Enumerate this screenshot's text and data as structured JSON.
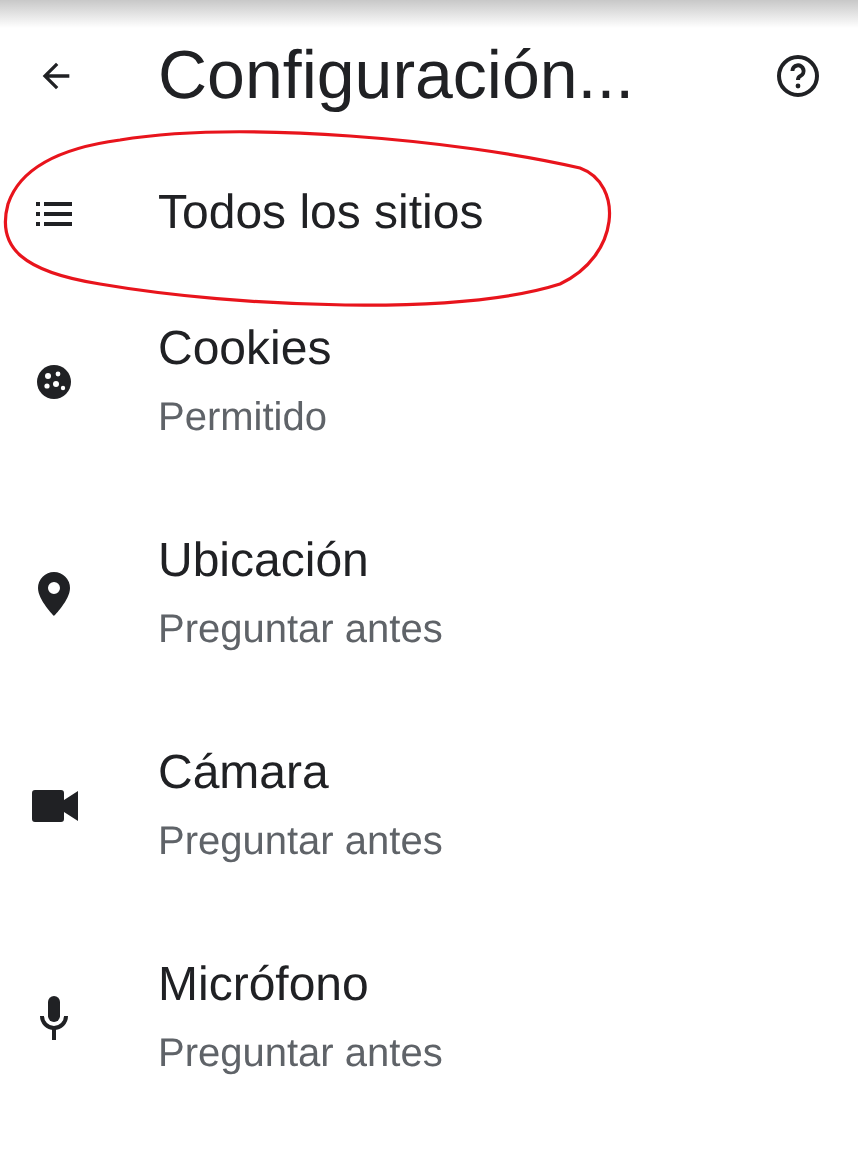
{
  "header": {
    "title": "Configuración..."
  },
  "items": [
    {
      "kind": "list",
      "label": "Todos los sitios"
    },
    {
      "kind": "cookie",
      "label": "Cookies",
      "status": "Permitido"
    },
    {
      "kind": "location",
      "label": "Ubicación",
      "status": "Preguntar antes"
    },
    {
      "kind": "camera",
      "label": "Cámara",
      "status": "Preguntar antes"
    },
    {
      "kind": "mic",
      "label": "Micrófono",
      "status": "Preguntar antes"
    }
  ]
}
